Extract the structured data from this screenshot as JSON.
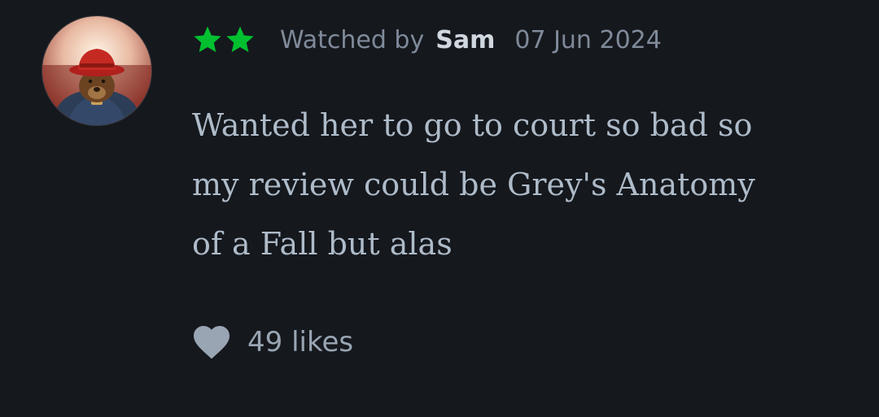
{
  "review": {
    "rating_stars": 2,
    "star_color": "#00c030",
    "watched_prefix": "Watched by",
    "username": "Sam",
    "date": "07 Jun 2024",
    "body_lines": [
      "Wanted her to go to court so bad so",
      "my review could be Grey's Anatomy",
      "of a Fall but alas"
    ],
    "likes_label": "49 likes",
    "avatar_icon": "user-avatar-bear-in-red-hat",
    "heart_icon": "heart-icon"
  },
  "colors": {
    "background": "#15181d",
    "body_text": "#aebbc9",
    "meta_text": "#7f8a99",
    "username_text": "#d0d7df",
    "likes_text": "#99a5b3"
  }
}
